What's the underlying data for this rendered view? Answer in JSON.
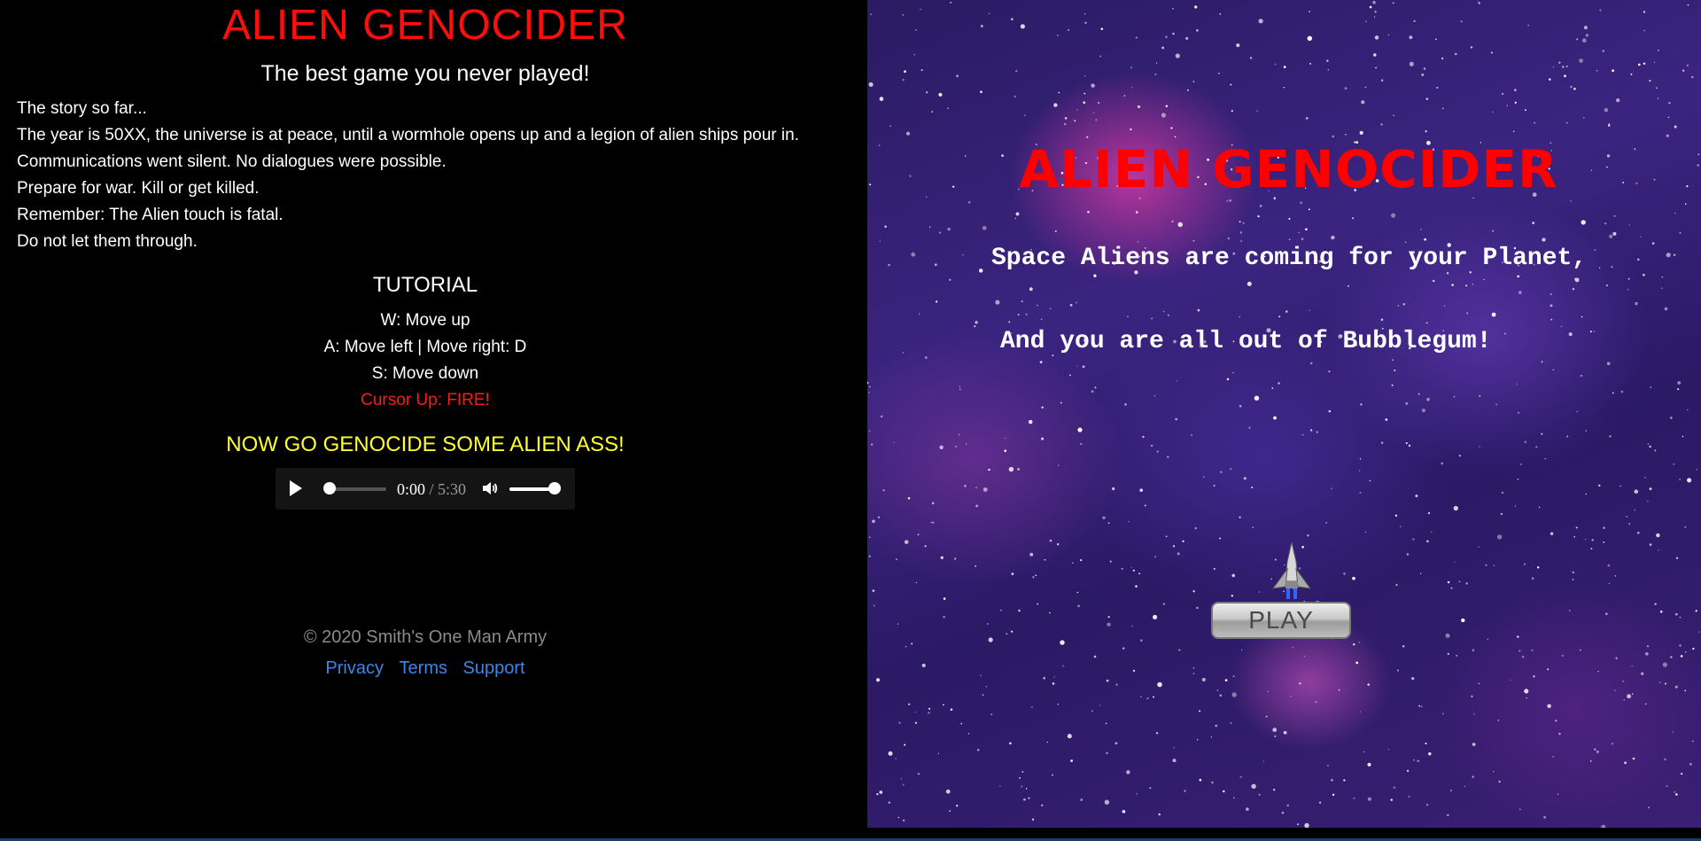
{
  "header": {
    "title": "ALIEN GENOCIDER",
    "subtitle": "The best game you never played!"
  },
  "story": {
    "lines": [
      "The story so far...",
      "The year is 50XX, the universe is at peace, until a wormhole opens up and a legion of alien ships pour in.",
      "Communications went silent. No dialogues were possible.",
      "Prepare for war. Kill or get killed.",
      "Remember: The Alien touch is fatal.",
      "Do not let them through."
    ]
  },
  "tutorial": {
    "title": "TUTORIAL",
    "controls": [
      "W: Move up",
      "A: Move left | Move right: D",
      "S: Move down",
      "Cursor Up: FIRE!"
    ],
    "call_to_action": "NOW GO GENOCIDE SOME ALIEN ASS!"
  },
  "audio_player": {
    "current_time": "0:00",
    "separator": " / ",
    "duration": "5:30",
    "progress": 0.0,
    "volume": 1.0,
    "play_icon": "play-icon",
    "volume_icon": "volume-icon"
  },
  "footer": {
    "copyright": "© 2020 Smith's One Man Army",
    "links": [
      "Privacy",
      "Terms",
      "Support"
    ]
  },
  "game": {
    "title": "ALIEN GENOCIDER",
    "tagline_1": "Space Aliens are coming for your Planet,",
    "tagline_2": "And you are all out of Bubblegum!",
    "play_label": "PLAY",
    "ship_icon": "spaceship-icon"
  },
  "colors": {
    "title_red": "#ff0d0d",
    "cta_yellow": "#ffff2a",
    "link_blue": "#3b86e8",
    "fire_red": "#ff1a1a"
  }
}
